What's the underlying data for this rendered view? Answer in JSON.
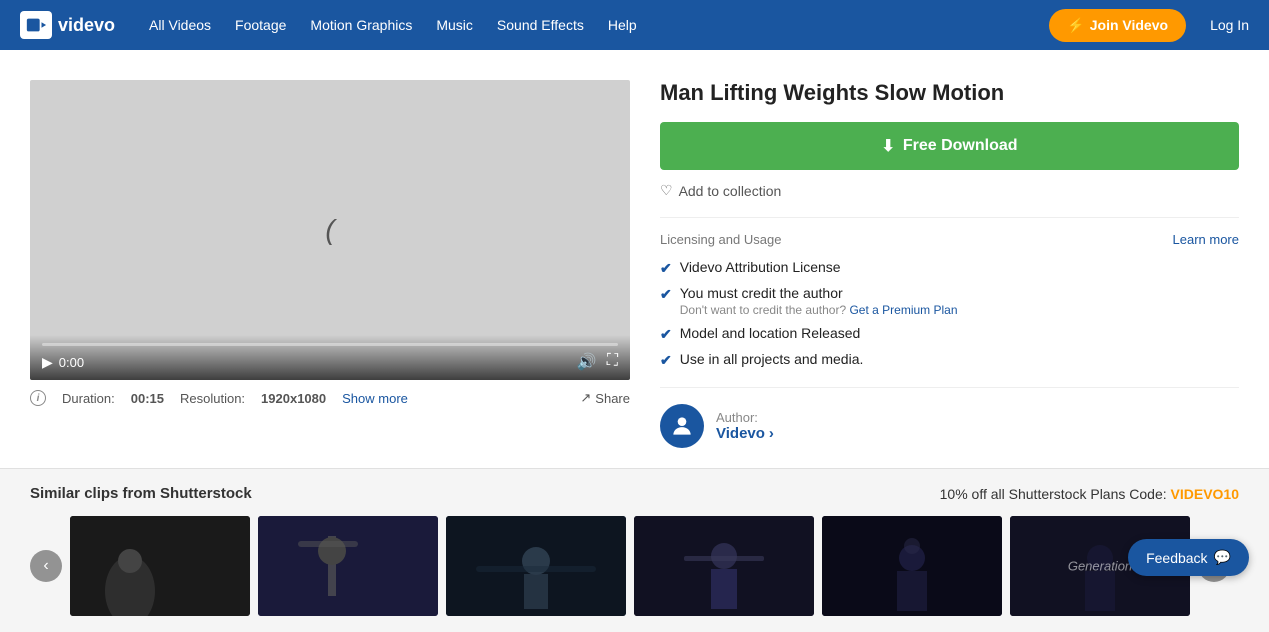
{
  "navbar": {
    "logo_text": "videvo",
    "links": [
      {
        "label": "All Videos",
        "id": "all-videos"
      },
      {
        "label": "Footage",
        "id": "footage"
      },
      {
        "label": "Motion Graphics",
        "id": "motion-graphics"
      },
      {
        "label": "Music",
        "id": "music"
      },
      {
        "label": "Sound Effects",
        "id": "sound-effects"
      },
      {
        "label": "Help",
        "id": "help"
      }
    ],
    "join_label": "Join Videvo",
    "login_label": "Log In"
  },
  "video": {
    "title": "Man Lifting Weights Slow Motion",
    "duration_label": "Duration:",
    "duration_value": "00:15",
    "resolution_label": "Resolution:",
    "resolution_value": "1920x1080",
    "show_more": "Show more",
    "share_label": "Share",
    "time_display": "0:00",
    "cursor_char": "("
  },
  "download": {
    "button_label": "Free Download",
    "add_collection_label": "Add to collection"
  },
  "licensing": {
    "title": "Licensing and Usage",
    "learn_more": "Learn more",
    "items": [
      {
        "id": "attribution",
        "text": "Videvo Attribution License",
        "sub": null
      },
      {
        "id": "credit",
        "text": "You must credit the author",
        "sub": "Don't want to credit the author? Get a Premium Plan"
      },
      {
        "id": "model",
        "text": "Model and location Released",
        "sub": null
      },
      {
        "id": "projects",
        "text": "Use in all projects and media.",
        "sub": null
      }
    ],
    "premium_link_text": "Get a Premium Plan",
    "credit_prefix": "Don't want to credit the author?"
  },
  "author": {
    "label": "Author:",
    "name": "Videvo",
    "arrow": "›"
  },
  "shutterstock": {
    "section_title": "Similar clips from Shutterstock",
    "promo_text": "10% off all Shutterstock Plans",
    "code_label": "Code:",
    "promo_code": "VIDEVO10"
  },
  "feedback": {
    "label": "Feedback"
  },
  "icons": {
    "download": "⬇",
    "heart": "♡",
    "check": "✔",
    "lightning": "⚡",
    "share": "↗",
    "play": "▶",
    "volume": "🔊",
    "fullscreen": "⛶",
    "left_arrow": "‹",
    "right_arrow": "›",
    "camera": "📷",
    "chat": "💬"
  }
}
